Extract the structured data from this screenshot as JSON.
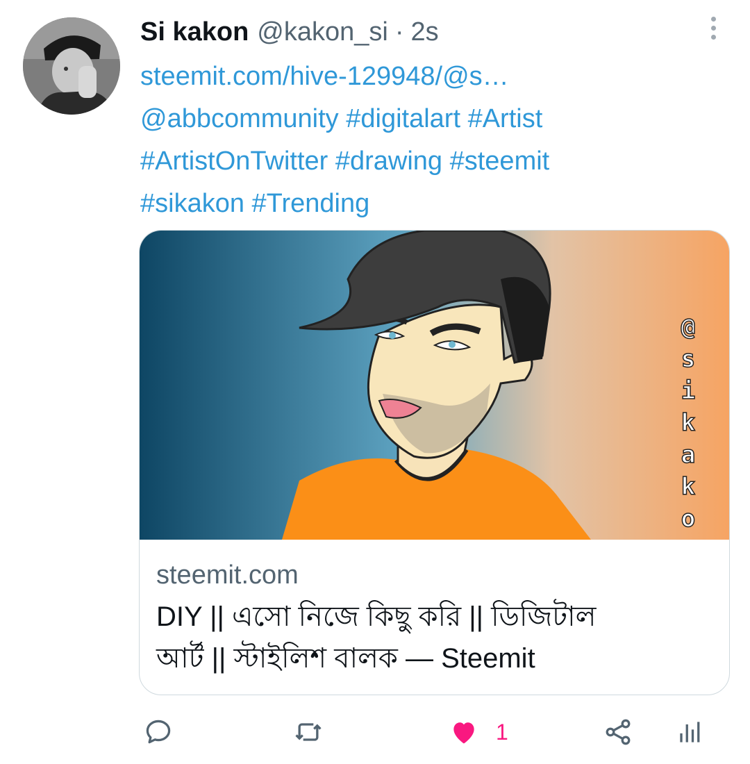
{
  "tweet": {
    "author_name": "Si kakon",
    "author_handle": "@kakon_si",
    "separator": "·",
    "timestamp": "2s",
    "text_lines": [
      "steemit.com/hive-129948/@s…",
      "@abbcommunity #digitalart #Artist",
      "#ArtistOnTwitter #drawing #steemit",
      "#sikakon #Trending"
    ]
  },
  "card": {
    "domain": "steemit.com",
    "title_line1": "DIY || এসো নিজে কিছু করি || ডিজিটাল",
    "title_line2": "আর্ট || স্টাইলিশ বালক — Steemit",
    "watermark": "@sikako"
  },
  "actions": {
    "like_count": "1",
    "like_color": "#f91880",
    "icon_color": "#536471"
  },
  "icons": {
    "more": "more-vertical-icon",
    "reply": "reply-icon",
    "retweet": "retweet-icon",
    "like": "heart-icon",
    "share": "share-icon",
    "analytics": "analytics-icon"
  }
}
